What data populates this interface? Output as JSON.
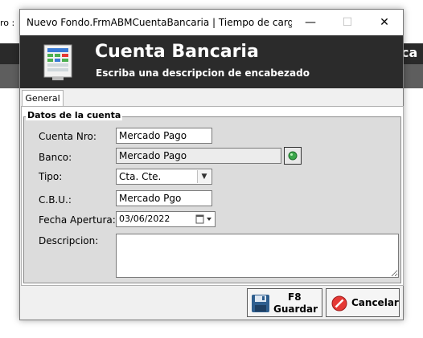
{
  "background": {
    "left_label": "ro :",
    "right_label": "ca"
  },
  "window": {
    "title": "Nuevo Fondo.FrmABMCuentaBancaria | Tiempo de carga = ...",
    "minimize_symbol": "—",
    "maximize_symbol": "☐",
    "close_symbol": "✕"
  },
  "header": {
    "title": "Cuenta Bancaria",
    "subtitle": "Escriba una descripcion de encabezado"
  },
  "tabs": [
    {
      "label": "General"
    }
  ],
  "group": {
    "legend": "Datos de la cuenta",
    "fields": {
      "cuenta_nro": {
        "label": "Cuenta Nro:",
        "value": "Mercado Pago"
      },
      "banco": {
        "label": "Banco:",
        "value": "Mercado Pago"
      },
      "tipo": {
        "label": "Tipo:",
        "value": "Cta. Cte."
      },
      "cbu": {
        "label": "C.B.U.:",
        "value": "Mercado Pgo"
      },
      "fecha": {
        "label": "Fecha Apertura:",
        "value": "03/06/2022"
      },
      "descripcion": {
        "label": "Descripcion:",
        "value": ""
      }
    }
  },
  "buttons": {
    "save": {
      "key": "F8",
      "label": "Guardar"
    },
    "cancel": {
      "label": "Cancelar"
    }
  },
  "colors": {
    "header_bg": "#2b2b2b",
    "group_bg": "#dcdcdc"
  }
}
